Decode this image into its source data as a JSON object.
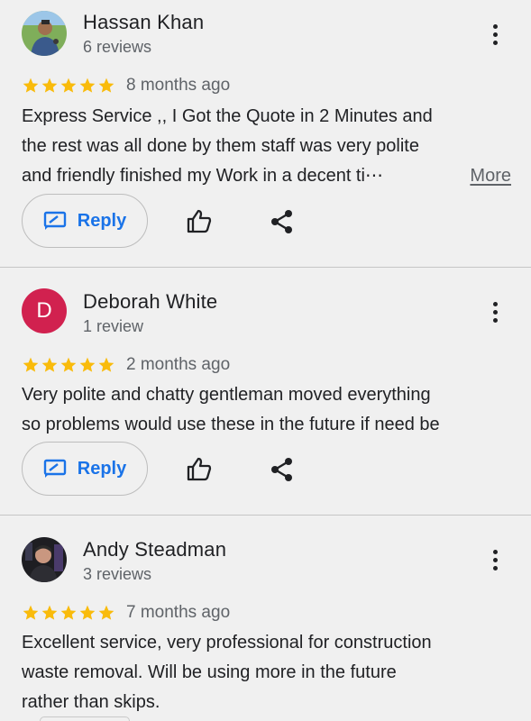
{
  "reviews": [
    {
      "name": "Hassan Khan",
      "count": "6 reviews",
      "rating": 5,
      "date": "8 months ago",
      "lines": [
        "Express Service ,, I Got the Quote in 2 Minutes and",
        "the rest was all done by them staff was very polite",
        "and friendly finished my Work in a decent ti⋯"
      ],
      "more_label": "More",
      "reply_label": "Reply"
    },
    {
      "name": "Deborah White",
      "count": "1 review",
      "avatar_letter": "D",
      "rating": 5,
      "date": "2 months ago",
      "lines": [
        "Very polite and chatty gentleman moved everything",
        "so problems would use these in the future if need be"
      ],
      "reply_label": "Reply"
    },
    {
      "name": "Andy Steadman",
      "count": "3 reviews",
      "rating": 5,
      "date": "7 months ago",
      "lines": [
        "Excellent service, very professional for construction",
        "waste removal. Will be using more in the future",
        "rather than skips."
      ]
    }
  ],
  "colors": {
    "background": "#f0f0f0",
    "star": "#f9bb0b",
    "reply": "#1a73e8",
    "avatar_letter_bg": "#d1214f"
  },
  "icons": {
    "more": "three-dots-vertical-icon",
    "reply": "reply-icon",
    "like": "thumb-up-icon",
    "share": "share-icon",
    "star": "star-icon"
  }
}
